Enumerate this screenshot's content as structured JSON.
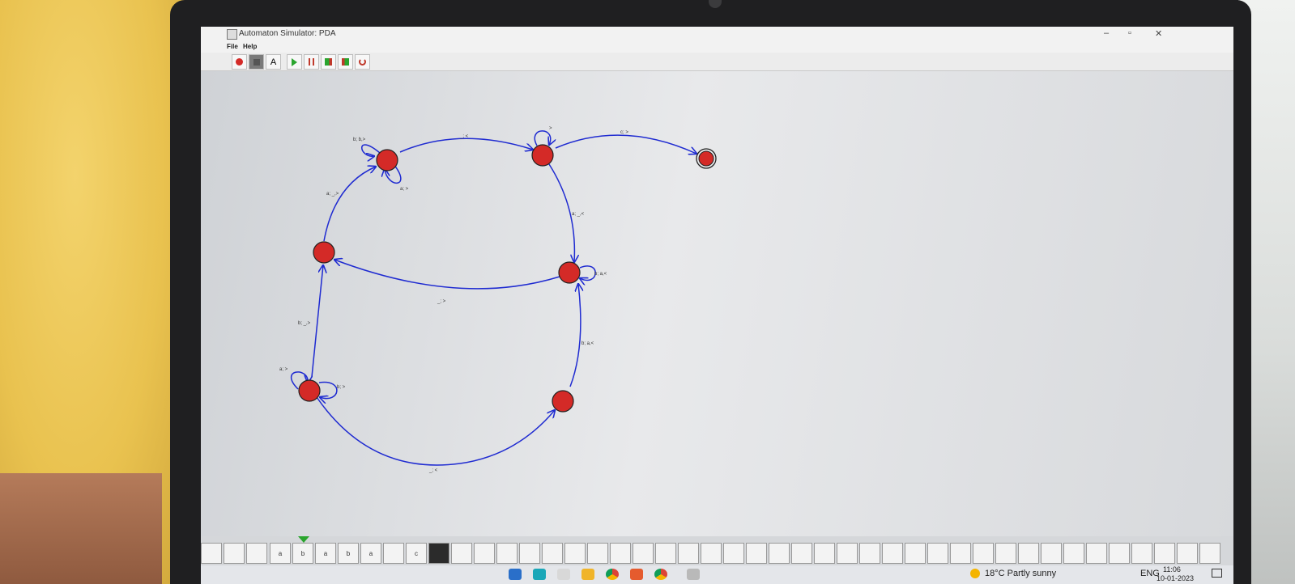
{
  "window": {
    "title": "Automaton Simulator: PDA",
    "controls": [
      "–",
      "▫",
      "✕"
    ]
  },
  "menu": [
    "File",
    "Help"
  ],
  "toolbar": {
    "text_tool_label": "A"
  },
  "transitions": {
    "q0_self_a": "a; >",
    "q0_self_b": "b; >",
    "q0_to_q1": "b; _,>",
    "q0_to_q6": "_; <",
    "q1_to_q2": "a; _,>",
    "q2_self_b": "b; b,>",
    "q2_self_a": "a; >",
    "q2_to_q3": "_; <",
    "q3_self": ">",
    "q3_to_q4": "c; >",
    "q3_to_q5": "a; _,<",
    "q5_self": "b; a,<",
    "q5_to_q1": "_; >",
    "q6_to_q5": "b; a,<"
  },
  "tape": {
    "cells": [
      "",
      "",
      "",
      "a",
      "b",
      "a",
      "b",
      "a",
      "",
      "c"
    ],
    "head_index": 4,
    "head_color": "#2aa52e"
  },
  "state_color": "#d42a27",
  "edge_color": "#1f2bd1",
  "taskbar": {
    "weather": "18°C  Partly sunny",
    "lang": "ENG",
    "time": "11:06",
    "date": "10-01-2023"
  }
}
